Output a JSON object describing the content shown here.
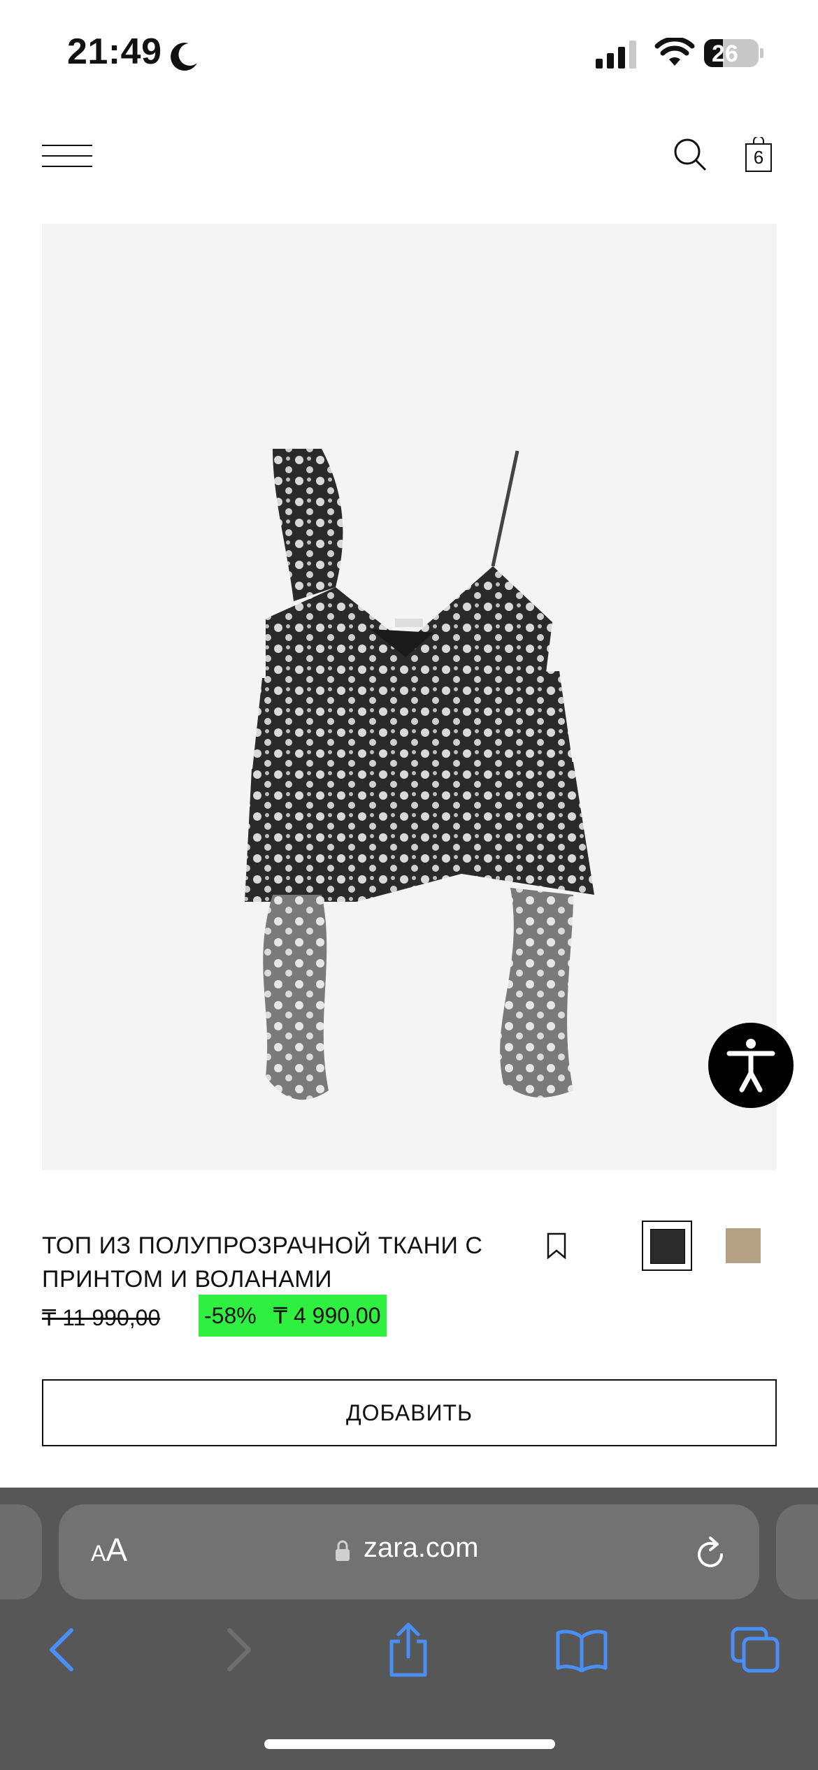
{
  "status_bar": {
    "time": "21:49",
    "battery": "26"
  },
  "header": {
    "bag_count": "6"
  },
  "product": {
    "title": "ТОП ИЗ ПОЛУПРОЗРАЧНОЙ ТКАНИ С ПРИНТОМ И ВОЛАНАМИ",
    "price_old": "₸ 11 990,00",
    "discount": "-58%",
    "price_new": "₸ 4 990,00",
    "colors": [
      "#2b2b2b",
      "#b5a184"
    ],
    "add_label": "ДОБАВИТЬ"
  },
  "browser": {
    "aa_small": "A",
    "aa_large": "A",
    "url": "zara.com"
  },
  "colors": {
    "discount_bg": "#2ff040",
    "browser_bar": "#575757",
    "icon_blue": "#4a8ff5"
  }
}
